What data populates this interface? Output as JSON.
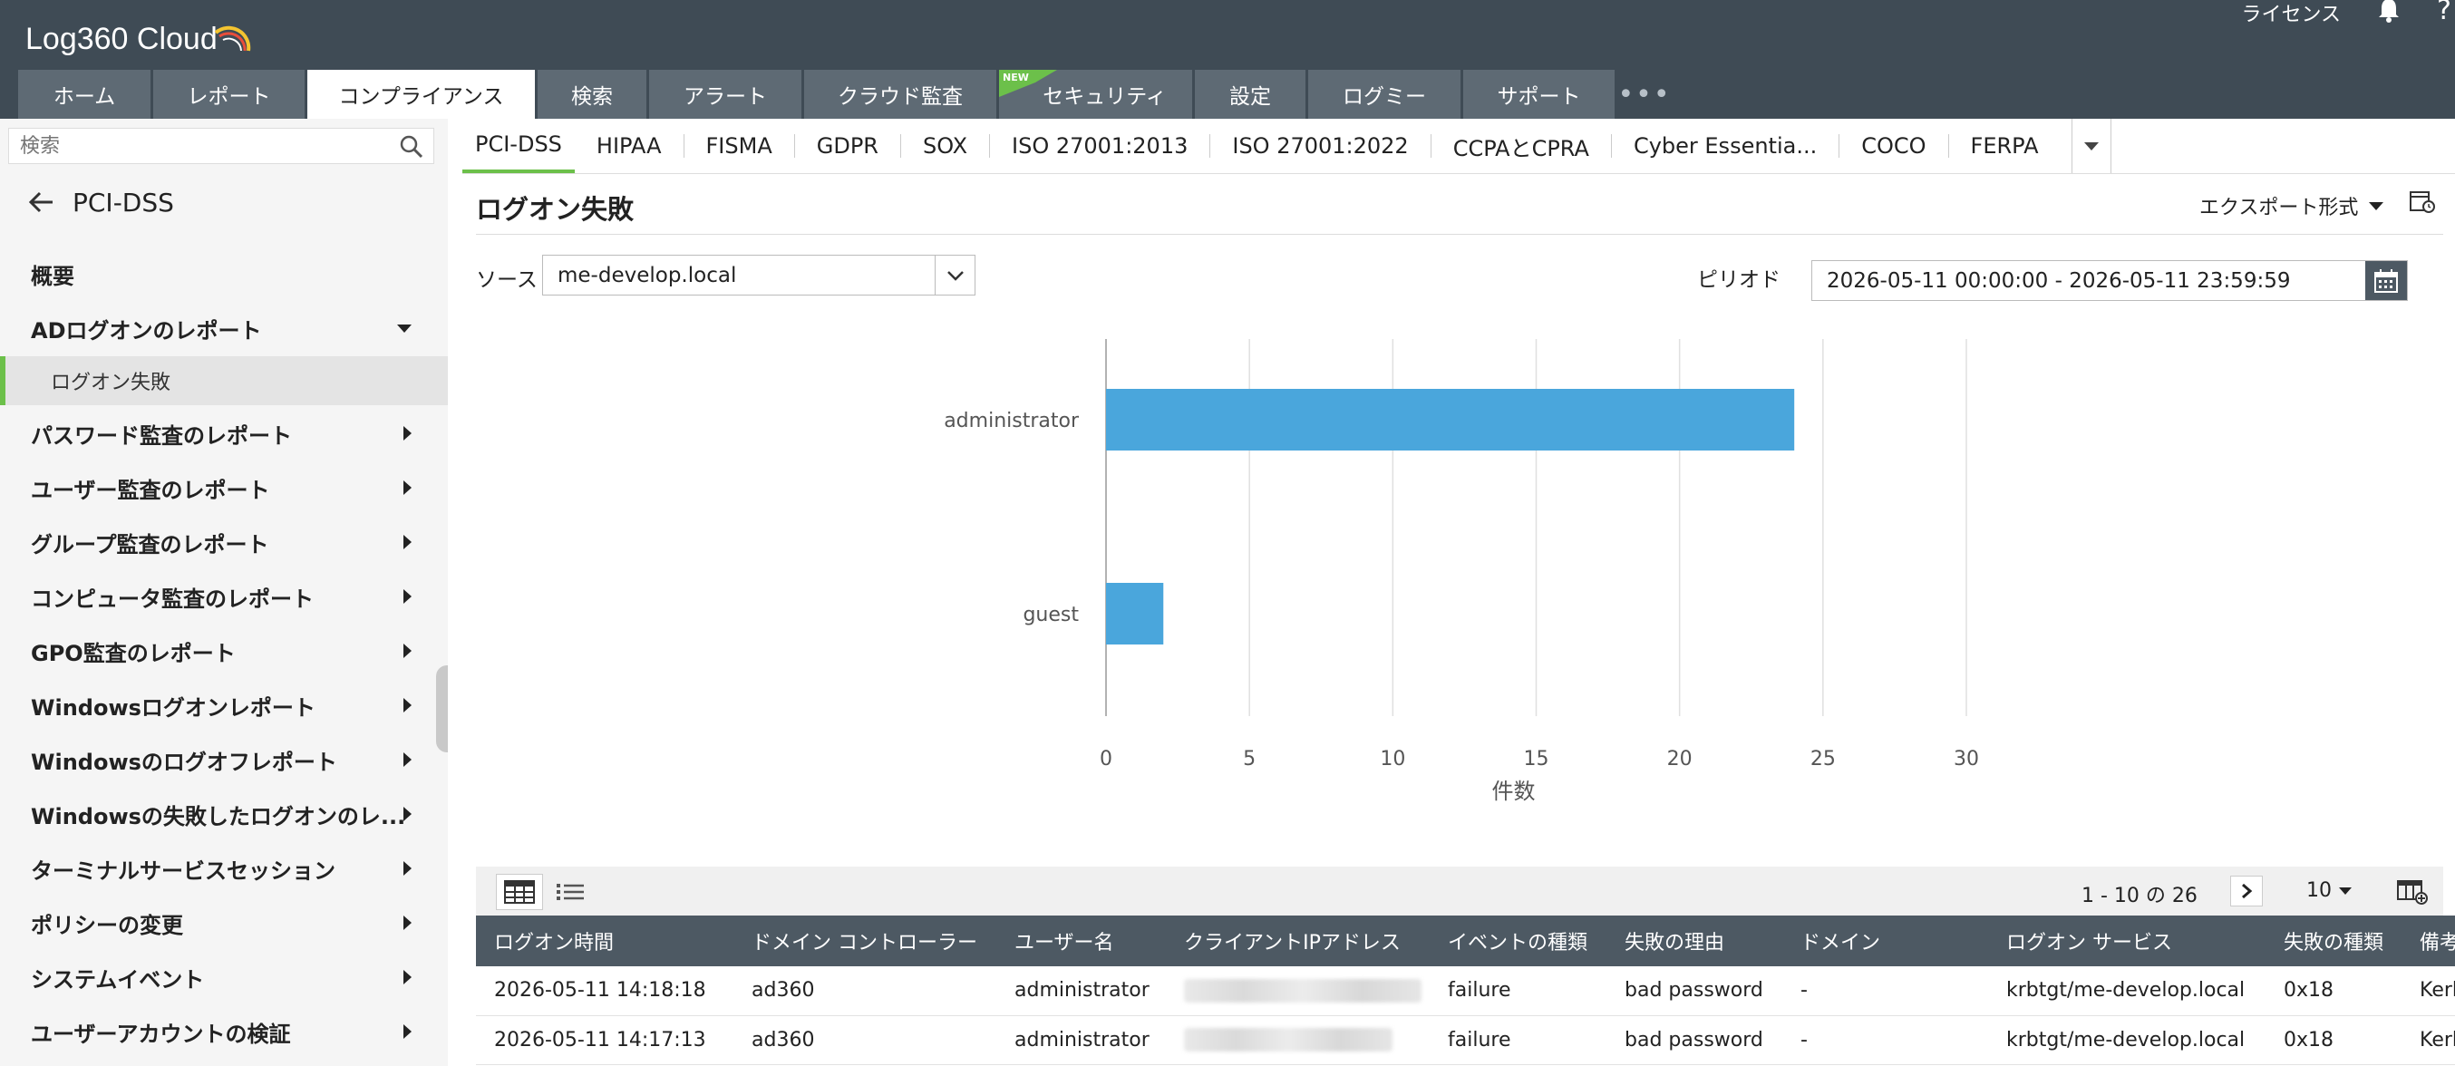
{
  "app": {
    "logo_text": "Log360 Cloud",
    "license_label": "ライセンス",
    "help_label": "?"
  },
  "main_tabs": [
    {
      "label": "ホーム"
    },
    {
      "label": "レポート"
    },
    {
      "label": "コンプライアンス",
      "active": true
    },
    {
      "label": "検索"
    },
    {
      "label": "アラート"
    },
    {
      "label": "クラウド監査"
    },
    {
      "label": "セキュリティ",
      "badge": "NEW"
    },
    {
      "label": "設定"
    },
    {
      "label": "ログミー"
    },
    {
      "label": "サポート"
    }
  ],
  "sidebar": {
    "search_placeholder": "検索",
    "back_title": "PCI-DSS",
    "items": [
      {
        "label": "概要",
        "caret": "none"
      },
      {
        "label": "ADログオンのレポート",
        "caret": "down"
      },
      {
        "label": "ログオン失敗",
        "sub": true,
        "selected": true
      },
      {
        "label": "パスワード監査のレポート",
        "caret": "right"
      },
      {
        "label": "ユーザー監査のレポート",
        "caret": "right"
      },
      {
        "label": "グループ監査のレポート",
        "caret": "right"
      },
      {
        "label": "コンピュータ監査のレポート",
        "caret": "right"
      },
      {
        "label": "GPO監査のレポート",
        "caret": "right"
      },
      {
        "label": "Windowsログオンレポート",
        "caret": "right"
      },
      {
        "label": "Windowsのログオフレポート",
        "caret": "right"
      },
      {
        "label": "Windowsの失敗したログオンのレ...",
        "caret": "right"
      },
      {
        "label": "ターミナルサービスセッション",
        "caret": "right"
      },
      {
        "label": "ポリシーの変更",
        "caret": "right"
      },
      {
        "label": "システムイベント",
        "caret": "right"
      },
      {
        "label": "ユーザーアカウントの検証",
        "caret": "right"
      }
    ]
  },
  "compliance_tabs": [
    {
      "label": "PCI-DSS",
      "active": true
    },
    {
      "label": "HIPAA"
    },
    {
      "label": "FISMA"
    },
    {
      "label": "GDPR"
    },
    {
      "label": "SOX"
    },
    {
      "label": "ISO 27001:2013"
    },
    {
      "label": "ISO 27001:2022"
    },
    {
      "label": "CCPAとCPRA"
    },
    {
      "label": "Cyber Essentia..."
    },
    {
      "label": "COCO"
    },
    {
      "label": "FERPA"
    }
  ],
  "report": {
    "title": "ログオン失敗",
    "export_label": "エクスポート形式",
    "source_label": "ソース",
    "source_value": "me-develop.local",
    "period_label": "ピリオド",
    "period_value": "2026-05-11 00:00:00 - 2026-05-11 23:59:59"
  },
  "chart_data": {
    "type": "bar",
    "orientation": "horizontal",
    "categories": [
      "administrator",
      "guest"
    ],
    "values": [
      24,
      2
    ],
    "xlabel": "件数",
    "ylabel": "",
    "xlim": [
      0,
      30
    ],
    "x_ticks": [
      0,
      5,
      10,
      15,
      20,
      25,
      30
    ],
    "grid": true,
    "bar_color": "#4aa6dc"
  },
  "table": {
    "pagination": "1 - 10 の 26",
    "per_page": "10",
    "columns": [
      "ログオン時間",
      "ドメイン コントローラー",
      "ユーザー名",
      "クライアントIPアドレス",
      "イベントの種類",
      "失敗の理由",
      "ドメイン",
      "ログオン サービス",
      "失敗の種類",
      "備考"
    ],
    "rows": [
      [
        "2026-05-11 14:18:18",
        "ad360",
        "administrator",
        "",
        "failure",
        "bad password",
        "-",
        "krbtgt/me-develop.local",
        "0x18",
        "Kerberos"
      ],
      [
        "2026-05-11 14:17:13",
        "ad360",
        "administrator",
        "",
        "failure",
        "bad password",
        "-",
        "krbtgt/me-develop.local",
        "0x18",
        "Kerberos"
      ]
    ]
  },
  "colors": {
    "header_bg": "#3f4b55",
    "tab_bg": "#5e6a74",
    "accent_green": "#6cc04a",
    "table_header_bg": "#4d5963",
    "bar_blue": "#4aa6dc"
  }
}
